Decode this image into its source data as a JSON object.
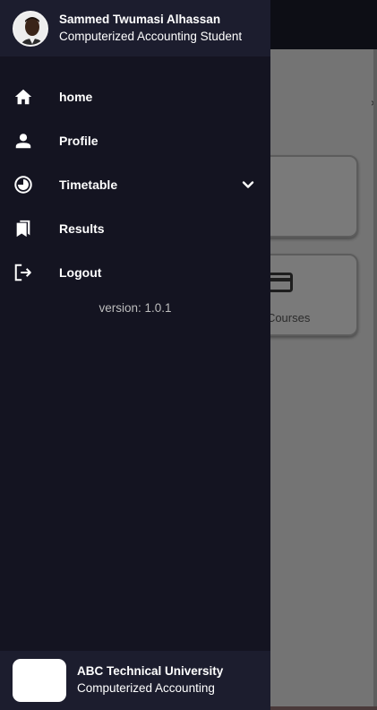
{
  "user": {
    "name": "Sammed Twumasi Alhassan",
    "role": "Computerized Accounting Student",
    "avatar_icon": "avatar-photo"
  },
  "nav": {
    "items": [
      {
        "label": "home",
        "icon": "home-icon"
      },
      {
        "label": "Profile",
        "icon": "person-icon"
      },
      {
        "label": "Timetable",
        "icon": "clock-icon",
        "expandable": true
      },
      {
        "label": "Results",
        "icon": "bookmark-icon"
      },
      {
        "label": "Logout",
        "icon": "logout-icon"
      }
    ]
  },
  "version": "version: 1.0.1",
  "footer": {
    "university": "ABC Technical University",
    "department": "Computerized Accounting"
  },
  "background": {
    "card2_label": "r Courses",
    "edge_mark": "×"
  },
  "colors": {
    "drawer_bg": "#141421",
    "header_bg": "#1c1d2e",
    "overlay_bg": "#747474",
    "text": "#ffffff",
    "muted_text": "#bdbdbd"
  }
}
